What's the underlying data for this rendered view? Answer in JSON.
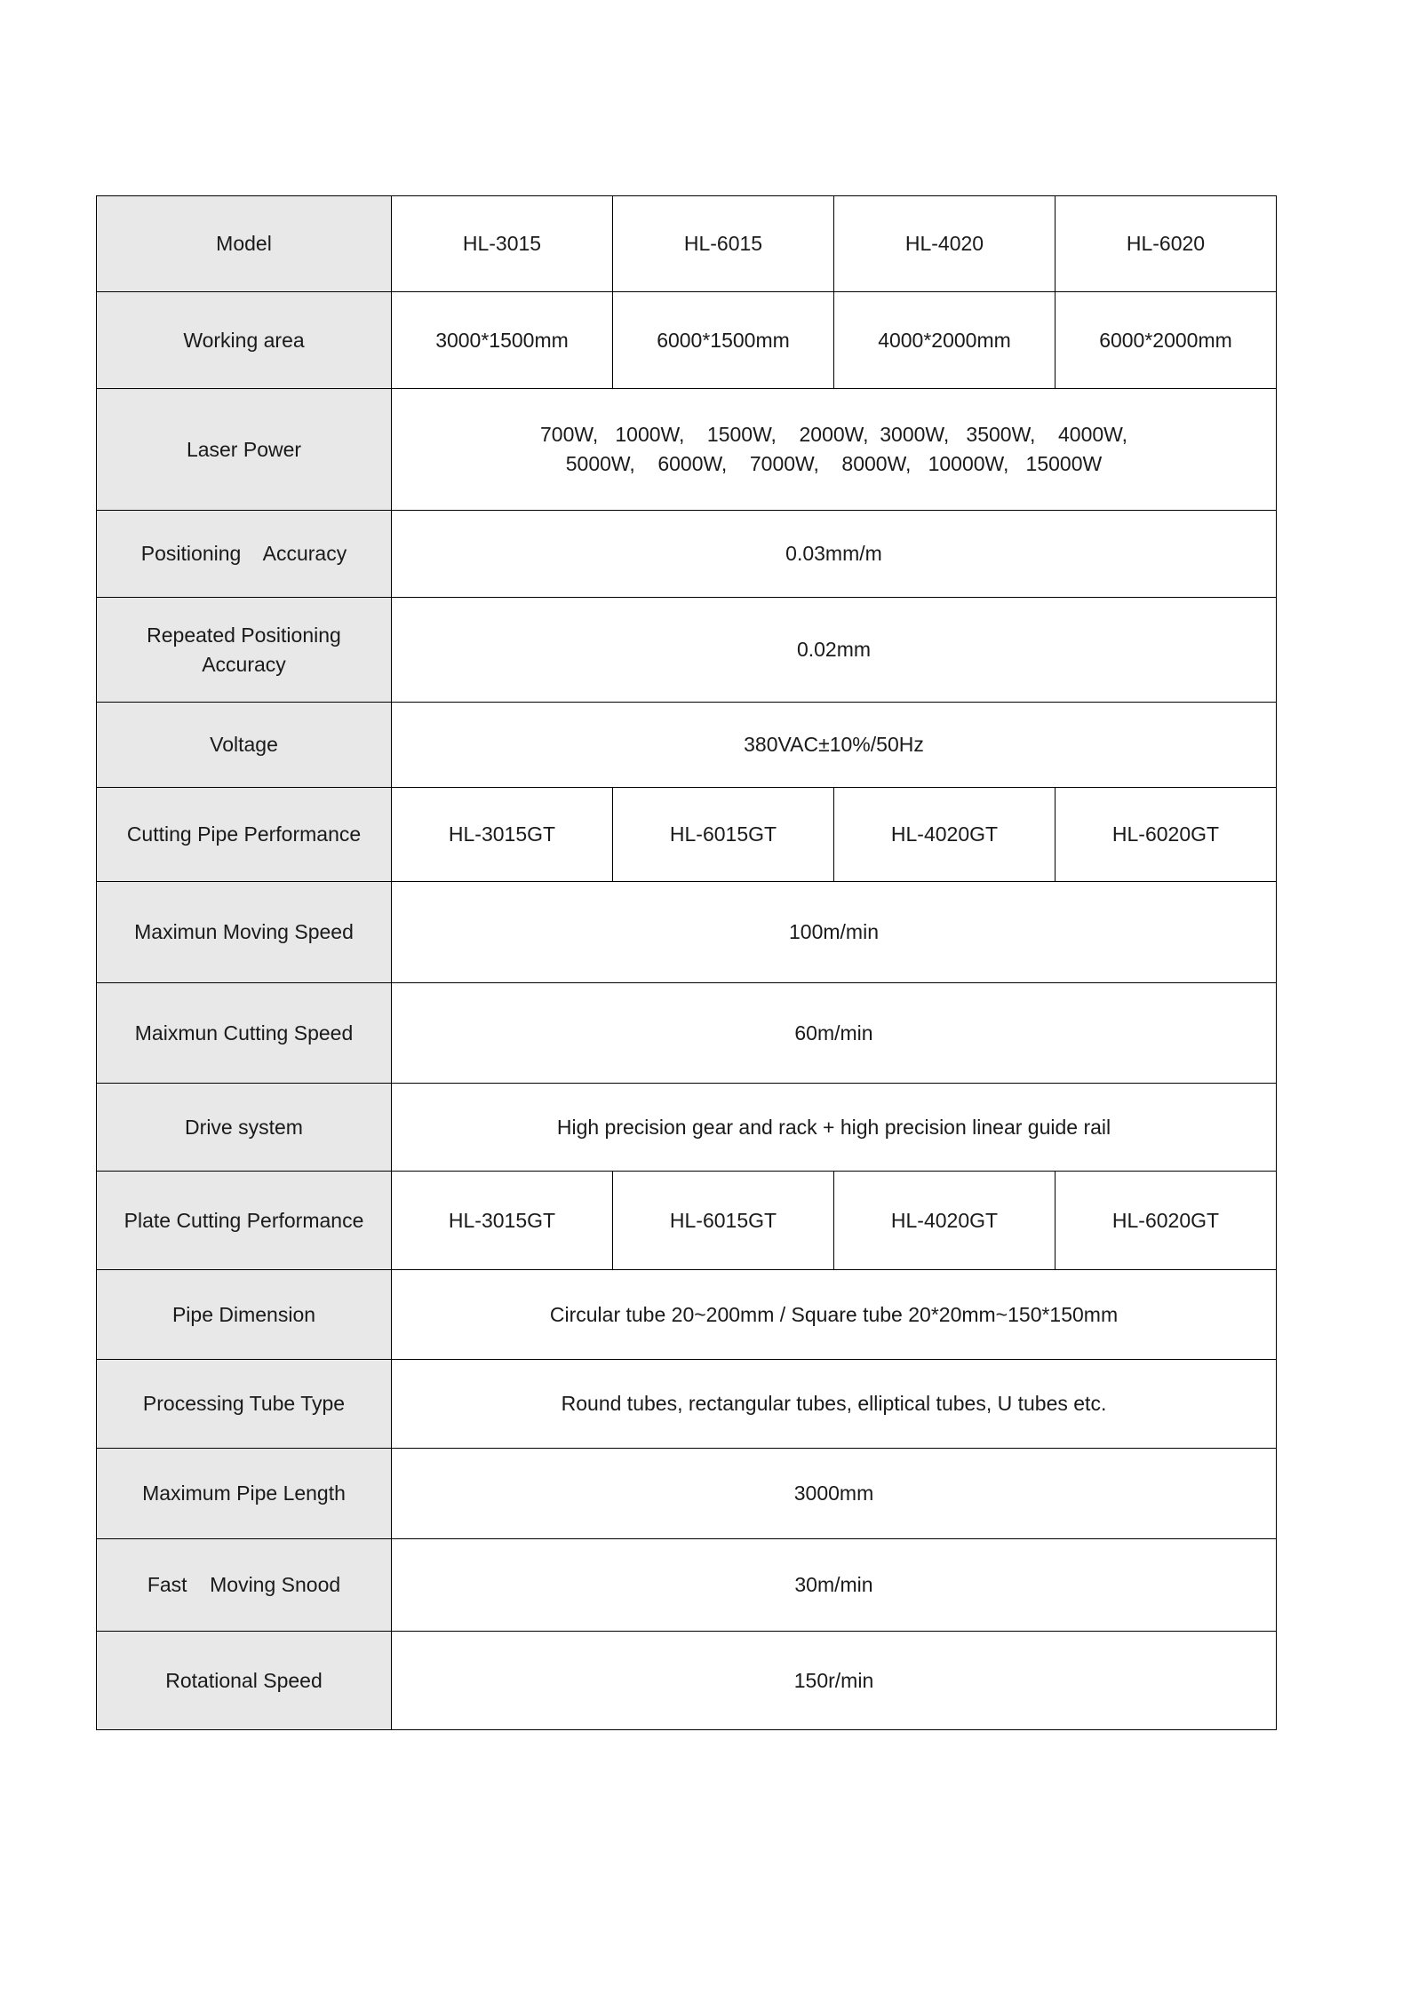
{
  "table": {
    "rows": [
      {
        "key": "model",
        "label": "Model",
        "type": "four",
        "values": [
          "HL-3015",
          "HL-6015",
          "HL-4020",
          "HL-6020"
        ]
      },
      {
        "key": "working_area",
        "label": "Working area",
        "type": "four",
        "values": [
          "3000*1500mm",
          "6000*1500mm",
          "4000*2000mm",
          "6000*2000mm"
        ]
      },
      {
        "key": "laser_power",
        "label": "Laser Power",
        "type": "span_power",
        "value_line1": "700W,   1000W,    1500W,    2000W,  3000W,   3500W,    4000W,",
        "value_line2": "5000W,    6000W,    7000W,    8000W,   10000W,   15000W"
      },
      {
        "key": "positioning_accuracy",
        "label": "Positioning    Accuracy",
        "type": "span",
        "value": "0.03mm/m"
      },
      {
        "key": "repeated_positioning_accuracy",
        "label": "Repeated Positioning\nAccuracy",
        "type": "span",
        "value": "0.02mm"
      },
      {
        "key": "voltage",
        "label": "Voltage",
        "type": "span",
        "value": "380VAC±10%/50Hz"
      },
      {
        "key": "cutting_pipe_performance",
        "label": "Cutting Pipe Performance",
        "type": "four",
        "values": [
          "HL-3015GT",
          "HL-6015GT",
          "HL-4020GT",
          "HL-6020GT"
        ]
      },
      {
        "key": "maximun_moving_speed",
        "label": "Maximun Moving Speed",
        "type": "span",
        "value": "100m/min"
      },
      {
        "key": "maixmun_cutting_speed",
        "label": "Maixmun Cutting Speed",
        "type": "span",
        "value": "60m/min"
      },
      {
        "key": "drive_system",
        "label": "Drive system",
        "type": "span",
        "value": "High precision gear and rack + high precision linear guide rail"
      },
      {
        "key": "plate_cutting_performance",
        "label": "Plate Cutting Performance",
        "type": "four",
        "values": [
          "HL-3015GT",
          "HL-6015GT",
          "HL-4020GT",
          "HL-6020GT"
        ]
      },
      {
        "key": "pipe_dimension",
        "label": "Pipe Dimension",
        "type": "span",
        "value": "Circular tube 20~200mm / Square tube 20*20mm~150*150mm"
      },
      {
        "key": "processing_tube_type",
        "label": "Processing Tube Type",
        "type": "span",
        "value": "Round tubes, rectangular tubes, elliptical tubes, U tubes etc."
      },
      {
        "key": "maximum_pipe_length",
        "label": "Maximum Pipe Length",
        "type": "span",
        "value": "3000mm"
      },
      {
        "key": "fast_moving_snood",
        "label": "Fast    Moving Snood",
        "type": "span",
        "value": "30m/min"
      },
      {
        "key": "rotational_speed",
        "label": "Rotational Speed",
        "type": "span",
        "value": "150r/min"
      }
    ]
  },
  "colors": {
    "label_background": "#e8e8e8",
    "cell_background": "#ffffff",
    "border": "#000000",
    "text": "#1a1a1a",
    "page_background": "#ffffff"
  }
}
